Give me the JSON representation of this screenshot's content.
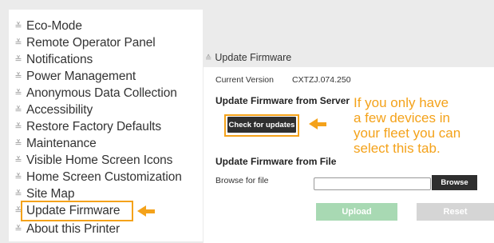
{
  "sidebar": {
    "items": [
      {
        "label": "Eco-Mode"
      },
      {
        "label": "Remote Operator Panel"
      },
      {
        "label": "Notifications"
      },
      {
        "label": "Power Management"
      },
      {
        "label": "Anonymous Data Collection"
      },
      {
        "label": "Accessibility"
      },
      {
        "label": "Restore Factory Defaults"
      },
      {
        "label": "Maintenance"
      },
      {
        "label": "Visible Home Screen Icons"
      },
      {
        "label": "Home Screen Customization"
      },
      {
        "label": "Site Map"
      },
      {
        "label": "Update Firmware"
      },
      {
        "label": "About this Printer"
      }
    ],
    "expand_icon": "chevron-double-down-icon"
  },
  "panel": {
    "title": "Update Firmware",
    "collapse_icon": "chevron-double-up-icon",
    "current_version_label": "Current Version",
    "current_version_value": "CXTZJ.074.250",
    "server_heading": "Update Firmware from Server",
    "check_button": "Check for updates",
    "file_heading": "Update Firmware from File",
    "browse_label": "Browse for file",
    "browse_button": "Browse",
    "upload_button": "Upload",
    "reset_button": "Reset"
  },
  "callout": {
    "lines": [
      "If you only have",
      "a few devices in",
      "your fleet you can",
      "select this tab."
    ]
  },
  "colors": {
    "accent": "#f4a21a",
    "dark_button": "#2f2f2f",
    "upload_button": "#a8d9b3",
    "reset_button": "#d5d5d5"
  }
}
